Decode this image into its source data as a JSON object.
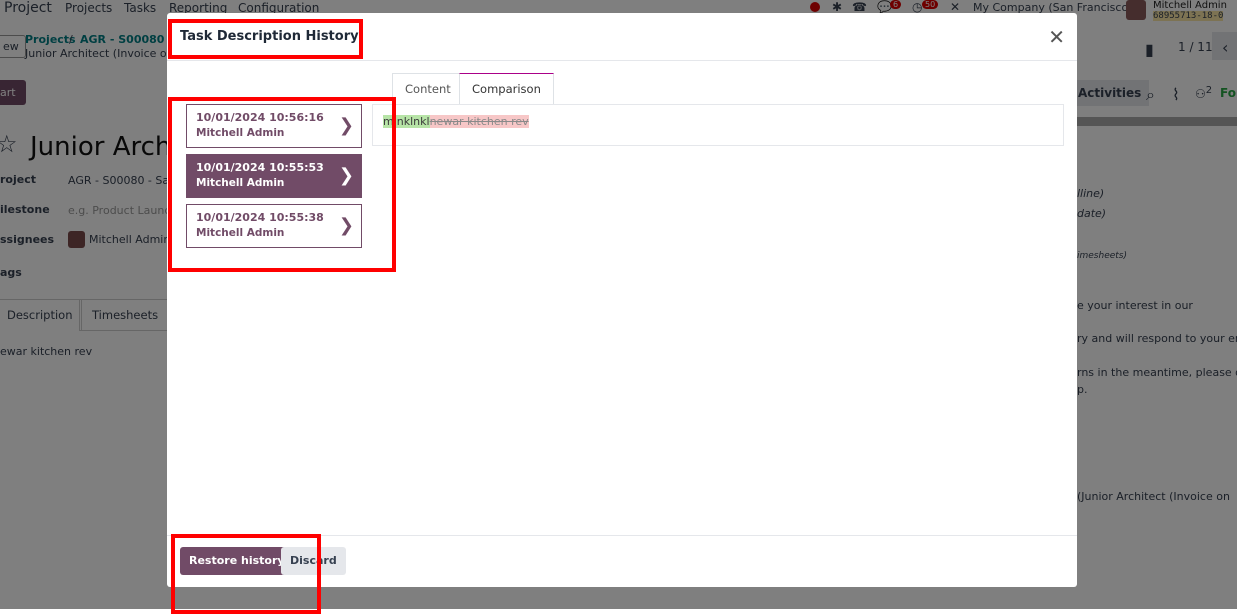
{
  "nav": {
    "app": "Project",
    "menu": [
      "Projects",
      "Tasks",
      "Reporting",
      "Configuration"
    ],
    "company": "My Company (San Francisco)",
    "user": "Mitchell Admin",
    "db": "68955713-18-0",
    "badges": {
      "chat": "6",
      "activity": "50"
    }
  },
  "background": {
    "breadcrumb": {
      "projects": "Projects",
      "sep": "/",
      "project": "AGR - S00080 - Sal",
      "task": "Junior Architect (Invoice on T"
    },
    "new_btn": "ew",
    "start_btn": "art",
    "pager": "1 / 11",
    "activities": "Activities",
    "followers": "2",
    "follow": "Fol",
    "title": "Junior Arch",
    "fields": [
      {
        "label": "roject",
        "value": "AGR - S00080 - Sales"
      },
      {
        "label": "ilestone",
        "value": "e.g. Product Launch"
      },
      {
        "label": "ssignees",
        "value": "Mitchell Admin"
      },
      {
        "label": "ags",
        "value": ""
      }
    ],
    "tabs": [
      "Description",
      "Timesheets"
    ],
    "description": "ewar kitchen rev",
    "right_texts": [
      "lline)",
      "date)",
      "imesheets)",
      "e your interest in our",
      "ry and will respond to your ema",
      "rns in the meantime, please do",
      "p.",
      "(Junior Architect (Invoice on"
    ]
  },
  "modal": {
    "title": "Task Description History",
    "history": [
      {
        "date": "10/01/2024 10:56:16",
        "user": "Mitchell Admin",
        "selected": false
      },
      {
        "date": "10/01/2024 10:55:53",
        "user": "Mitchell Admin",
        "selected": true
      },
      {
        "date": "10/01/2024 10:55:38",
        "user": "Mitchell Admin",
        "selected": false
      }
    ],
    "tabs": [
      {
        "label": "Content",
        "active": false
      },
      {
        "label": "Comparison",
        "active": true
      }
    ],
    "comparison": {
      "inserted": "mlnklnkl",
      "deleted": "newar kitchen rev"
    },
    "restore_label": "Restore history",
    "discard_label": "Discard"
  },
  "colors": {
    "primary": "#714b67",
    "annotation": "#ff0000",
    "inserted": "#b7e4a7",
    "deleted": "#f7c7c7"
  }
}
